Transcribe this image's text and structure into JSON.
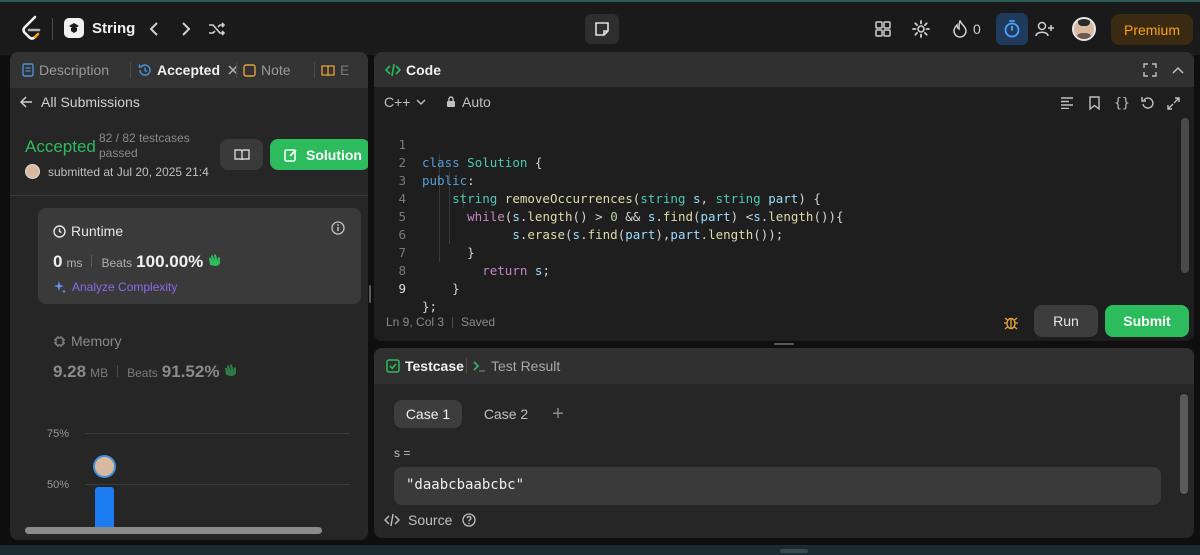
{
  "topbar": {
    "problem_title": "String",
    "streak_count": "0",
    "premium_label": "Premium"
  },
  "left_panel": {
    "tabs": [
      {
        "label": "Description"
      },
      {
        "label": "Accepted"
      },
      {
        "label": "Note"
      },
      {
        "label": "E"
      }
    ],
    "back_label": "All Submissions",
    "status": "Accepted",
    "testcases_line1": "82 / 82 testcases",
    "testcases_line2": "passed",
    "submitted_text": "submitted at Jul 20, 2025 21:4",
    "solution_label": "Solution",
    "runtime": {
      "title": "Runtime",
      "value": "0",
      "unit": "ms",
      "beats_label": "Beats",
      "beats_value": "100.00%",
      "analyze_label": "Analyze Complexity"
    },
    "memory": {
      "title": "Memory",
      "value": "9.28",
      "unit": "MB",
      "beats_label": "Beats",
      "beats_value": "91.52%"
    },
    "chart": {
      "tick_75": "75%",
      "tick_50": "50%"
    }
  },
  "code_panel": {
    "title": "Code",
    "language": "C++",
    "mode": "Auto",
    "status_position": "Ln 9, Col 3",
    "status_saved": "Saved",
    "run_label": "Run",
    "submit_label": "Submit",
    "line_numbers": [
      "1",
      "2",
      "3",
      "4",
      "5",
      "6",
      "7",
      "8",
      "9"
    ]
  },
  "testcase_panel": {
    "tab_testcase": "Testcase",
    "tab_result": "Test Result",
    "cases": [
      "Case 1",
      "Case 2"
    ],
    "add_symbol": "+",
    "var_label": "s =",
    "var_value": "\"daabcbaabcbc\"",
    "source_label": "Source"
  },
  "colors": {
    "accent_green": "#2cbb5d",
    "premium": "#ffa116",
    "code_bg": "#1e1e1e",
    "panel_bg": "#262626"
  }
}
